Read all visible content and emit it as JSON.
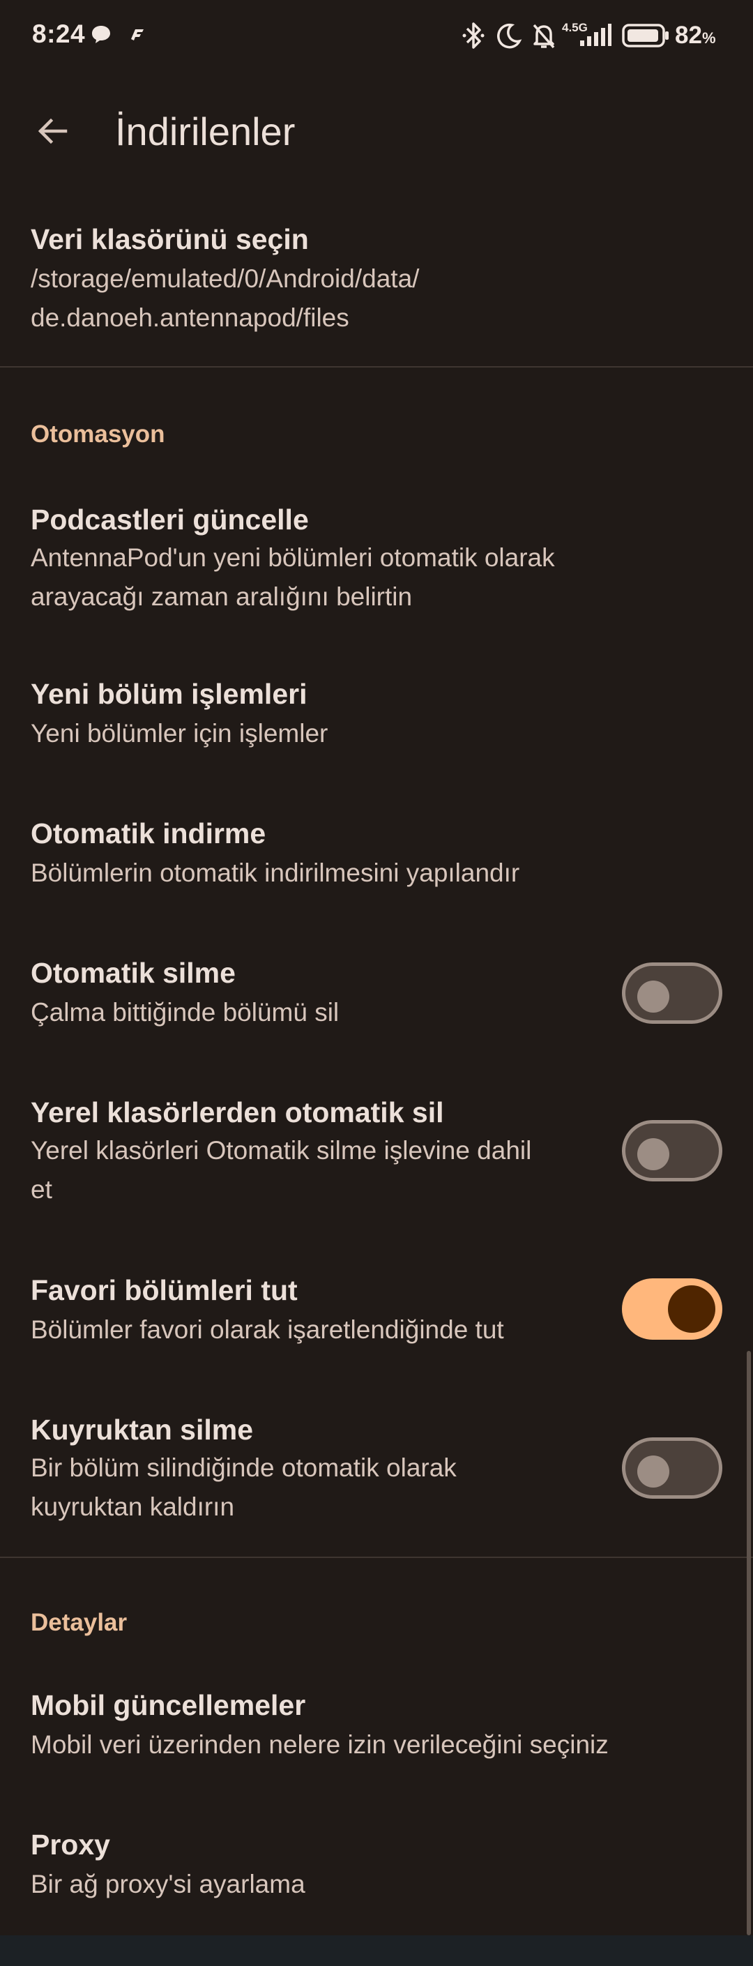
{
  "status_bar": {
    "time": "8:24",
    "network": "4.5G",
    "battery_percent": "82",
    "battery_unit": "%"
  },
  "app_bar": {
    "title": "İndirilenler"
  },
  "storage": {
    "title": "Veri klasörünü seçin",
    "summary_line1": "/storage/emulated/0/Android/data/",
    "summary_line2": "de.danoeh.antennapod/files"
  },
  "automation": {
    "header": "Otomasyon",
    "update_podcasts": {
      "title": "Podcastleri güncelle",
      "summary_line1": "AntennaPod'un yeni bölümleri otomatik olarak",
      "summary_line2": "arayacağı zaman aralığını belirtin"
    },
    "new_episode_actions": {
      "title": "Yeni bölüm işlemleri",
      "summary": "Yeni bölümler için işlemler"
    },
    "auto_download": {
      "title": "Otomatik indirme",
      "summary": "Bölümlerin otomatik indirilmesini yapılandır"
    },
    "auto_delete": {
      "title": "Otomatik silme",
      "summary": "Çalma bittiğinde bölümü sil",
      "enabled": false
    },
    "auto_delete_local": {
      "title": "Yerel klasörlerden otomatik sil",
      "summary_line1": "Yerel klasörleri Otomatik silme işlevine dahil",
      "summary_line2": "et",
      "enabled": false
    },
    "keep_favorites": {
      "title": "Favori bölümleri tut",
      "summary": "Bölümler favori olarak işaretlendiğinde tut",
      "enabled": true
    },
    "remove_from_queue": {
      "title": "Kuyruktan silme",
      "summary_line1": "Bir bölüm silindiğinde otomatik olarak",
      "summary_line2": "kuyruktan kaldırın",
      "enabled": false
    }
  },
  "details": {
    "header": "Detaylar",
    "mobile_updates": {
      "title": "Mobil güncellemeler",
      "summary": "Mobil veri üzerinden nelere izin verileceğini seçiniz"
    },
    "proxy": {
      "title": "Proxy",
      "summary": "Bir ağ proxy'si ayarlama"
    }
  },
  "colors": {
    "background": "#201a17",
    "accent": "#ffb77c",
    "section_header": "#ebbf9b"
  }
}
